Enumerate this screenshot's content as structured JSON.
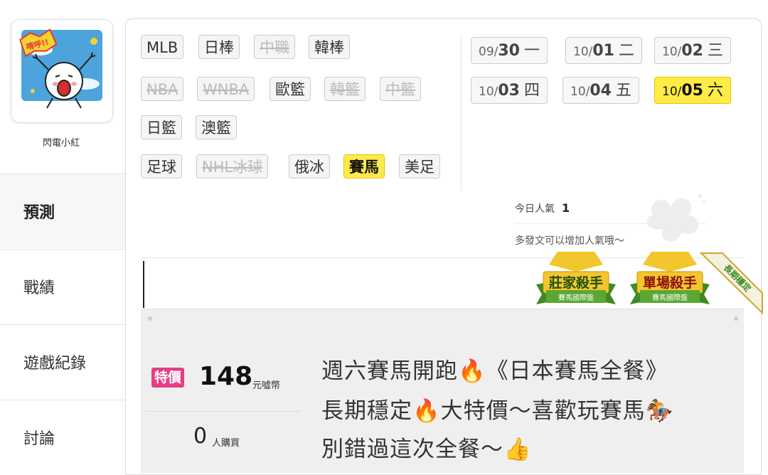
{
  "user": {
    "name": "閃電小紅",
    "avatar_text": "唷呼!!"
  },
  "nav": [
    {
      "label": "預測",
      "active": true
    },
    {
      "label": "戰績",
      "active": false
    },
    {
      "label": "遊戲紀錄",
      "active": false
    },
    {
      "label": "討論",
      "active": false
    }
  ],
  "sports": [
    {
      "label": "MLB",
      "state": "normal"
    },
    {
      "label": "日棒",
      "state": "normal"
    },
    {
      "label": "中職",
      "state": "disabled"
    },
    {
      "label": "韓棒",
      "state": "normal"
    },
    {
      "label": "NBA",
      "state": "disabled"
    },
    {
      "label": "WNBA",
      "state": "disabled"
    },
    {
      "label": "歐籃",
      "state": "normal"
    },
    {
      "label": "韓籃",
      "state": "disabled"
    },
    {
      "label": "中籃",
      "state": "disabled"
    },
    {
      "label": "日籃",
      "state": "normal"
    },
    {
      "label": "澳籃",
      "state": "normal"
    },
    {
      "label": "足球",
      "state": "normal"
    },
    {
      "label": "NHL冰球",
      "state": "disabled"
    },
    {
      "label": "俄冰",
      "state": "normal"
    },
    {
      "label": "賽馬",
      "state": "selected"
    },
    {
      "label": "美足",
      "state": "normal"
    }
  ],
  "dates": [
    {
      "md": "09/",
      "d": "30",
      "wd": "一",
      "selected": false
    },
    {
      "md": "10/",
      "d": "01",
      "wd": "二",
      "selected": false
    },
    {
      "md": "10/",
      "d": "02",
      "wd": "三",
      "selected": false
    },
    {
      "md": "10/",
      "d": "03",
      "wd": "四",
      "selected": false
    },
    {
      "md": "10/",
      "d": "04",
      "wd": "五",
      "selected": false
    },
    {
      "md": "10/",
      "d": "05",
      "wd": "六",
      "selected": true
    }
  ],
  "popularity": {
    "label": "今日人氣",
    "value": "1",
    "note": "多發文可以增加人氣哦～"
  },
  "badges": [
    {
      "title": "莊家殺手",
      "sub": "賽馬國際盤"
    },
    {
      "title": "單場殺手",
      "sub": "賽馬國際盤"
    }
  ],
  "ribbon": "長期穩定",
  "offer": {
    "tag": "特價",
    "price": "148",
    "price_unit": "元噓幣",
    "buyers": "0",
    "buyers_unit": "人購買",
    "title_lines": [
      "週六賽馬開跑🔥《日本賽馬全餐》",
      "長期穩定🔥大特價～喜歡玩賽馬🏇",
      "別錯過這次全餐～👍"
    ]
  },
  "colors": {
    "selected": "#ffe94f",
    "tag": "#e43f86",
    "badge_green": "#5aa832",
    "badge_gold": "#f2c62d"
  }
}
